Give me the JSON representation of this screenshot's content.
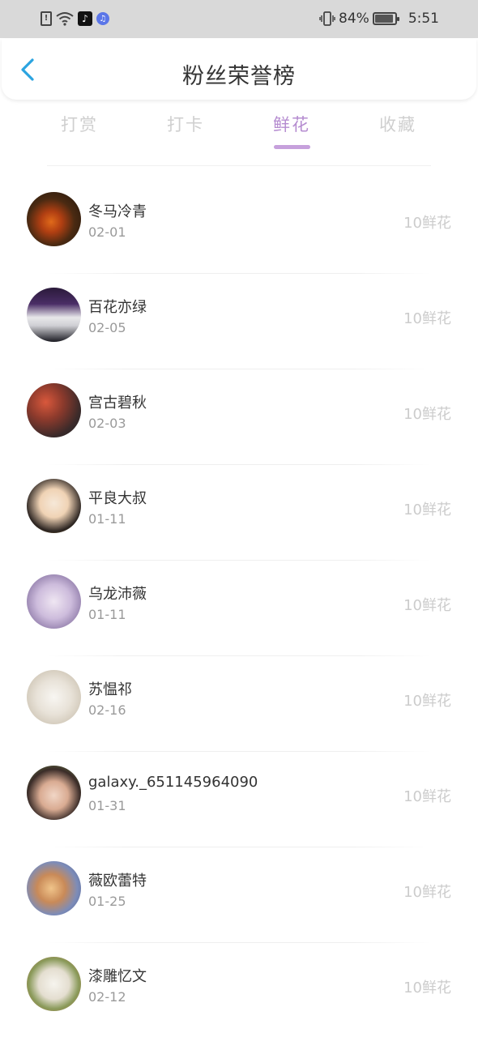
{
  "status_bar": {
    "battery_percent_label": "84%",
    "battery_level": 0.84,
    "time": "5:51",
    "icons": [
      "sim-alert-icon",
      "wifi-icon",
      "tiktok-icon",
      "music-app-icon",
      "vibrate-icon",
      "battery-icon"
    ]
  },
  "header": {
    "title": "粉丝荣誉榜",
    "back_icon": "chevron-left-icon",
    "accent": "#2ba4e0"
  },
  "tabs": [
    {
      "label": "打赏",
      "active": false
    },
    {
      "label": "打卡",
      "active": false
    },
    {
      "label": "鲜花",
      "active": true
    },
    {
      "label": "收藏",
      "active": false
    }
  ],
  "colors": {
    "active_tab": "#b58cd0",
    "inactive_tab": "#cfcfcf"
  },
  "fans": [
    {
      "name": "冬马冷青",
      "date": "02-01",
      "amount": "10鲜花"
    },
    {
      "name": "百花亦绿",
      "date": "02-05",
      "amount": "10鲜花"
    },
    {
      "name": "宫古碧秋",
      "date": "02-03",
      "amount": "10鲜花"
    },
    {
      "name": "平良大叔",
      "date": "01-11",
      "amount": "10鲜花"
    },
    {
      "name": "乌龙沛薇",
      "date": "01-11",
      "amount": "10鲜花"
    },
    {
      "name": "苏愠祁",
      "date": "02-16",
      "amount": "10鲜花"
    },
    {
      "name": "galaxy._651145964090",
      "date": "01-31",
      "amount": "10鲜花"
    },
    {
      "name": "薇欧蕾特",
      "date": "01-25",
      "amount": "10鲜花"
    },
    {
      "name": "漆雕忆文",
      "date": "02-12",
      "amount": "10鲜花"
    }
  ]
}
